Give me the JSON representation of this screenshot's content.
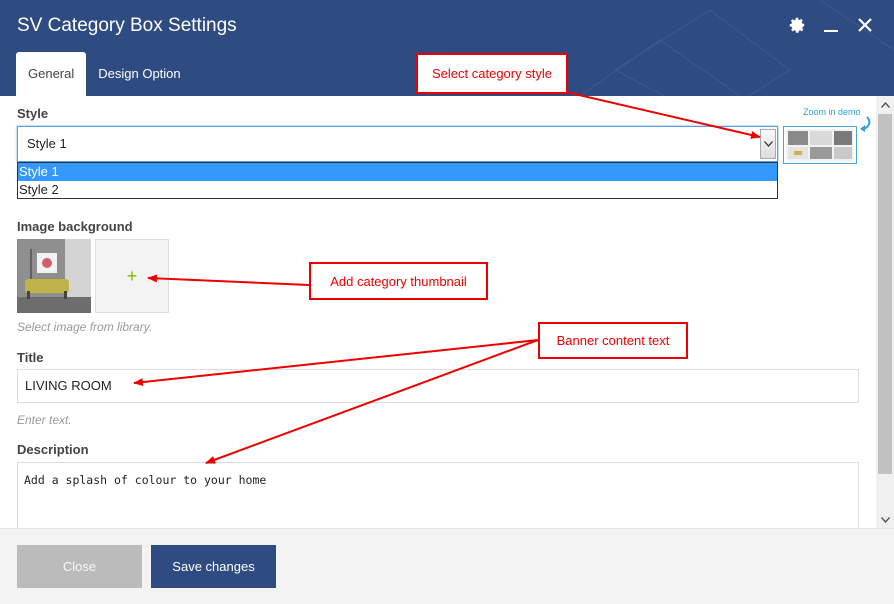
{
  "dialog": {
    "title": "SV Category Box Settings",
    "icons": [
      "gear-icon",
      "minimize-icon",
      "close-icon"
    ]
  },
  "tabs": [
    {
      "label": "General",
      "active": true
    },
    {
      "label": "Design Option",
      "active": false
    }
  ],
  "fields": {
    "style": {
      "label": "Style",
      "value": "Style 1",
      "options": [
        "Style 1",
        "Style 2"
      ],
      "zoom_link": "Zoom in demo"
    },
    "image_background": {
      "label": "Image background",
      "add_symbol": "+",
      "help": "Select image from library."
    },
    "title": {
      "label": "Title",
      "value": "LIVING ROOM",
      "help": "Enter text."
    },
    "description": {
      "label": "Description",
      "value": "Add a splash of colour to your home"
    }
  },
  "footer": {
    "close_label": "Close",
    "save_label": "Save changes"
  },
  "annotations": {
    "select_style": "Select category style",
    "add_thumbnail": "Add category thumbnail",
    "banner_text": "Banner content text"
  },
  "colors": {
    "header_bg": "#2e4c82",
    "primary_button": "#2e4c82",
    "annotation_red": "#e00000",
    "dropdown_highlight": "#3399ff",
    "add_icon_green": "#7ab800"
  }
}
